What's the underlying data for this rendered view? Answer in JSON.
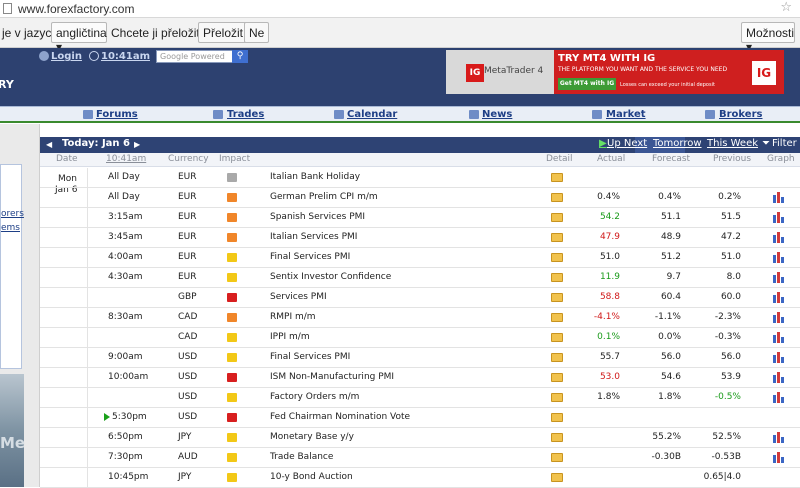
{
  "browser": {
    "url": "www.forexfactory.com"
  },
  "translate_bar": {
    "prefix": "je v jazyce",
    "language": "angličtina",
    "question": "Chcete ji přeložit?",
    "translate_btn": "Přeložit",
    "no_btn": "Ne",
    "options_btn": "Možnosti"
  },
  "header": {
    "logo_fragment": "RY",
    "login": "Login",
    "time": "10:41am",
    "search_placeholder": "Google Powered"
  },
  "ad": {
    "brand": "IG",
    "product": "MetaTrader 4",
    "headline": "TRY MT4 WITH IG",
    "subline": "THE PLATFORM YOU WANT AND THE SERVICE YOU NEED",
    "cta": "Get MT4 with IG",
    "disclaimer": "Losses can exceed your initial deposit"
  },
  "nav": {
    "forums": "Forums",
    "trades": "Trades",
    "calendar": "Calendar",
    "news": "News",
    "market": "Market",
    "brokers": "Brokers"
  },
  "left": {
    "link1": "orers",
    "link2": "ems",
    "img_text": "Me"
  },
  "calendar": {
    "today": "Today: Jan 6",
    "up_next": "Up Next",
    "tomorrow": "Tomorrow",
    "this_week": "This Week",
    "filter": "Filter",
    "columns": {
      "date": "Date",
      "time": "10:41am",
      "currency": "Currency",
      "impact": "Impact",
      "detail": "Detail",
      "actual": "Actual",
      "forecast": "Forecast",
      "previous": "Previous",
      "graph": "Graph"
    },
    "date_day": "Mon",
    "date_date": "Jan 6",
    "rows": [
      {
        "time": "All Day",
        "cur": "EUR",
        "impact": "gray",
        "event": "Italian Bank Holiday",
        "actual": "",
        "forecast": "",
        "previous": "",
        "actual_color": "",
        "graph": false
      },
      {
        "time": "All Day",
        "cur": "EUR",
        "impact": "orange",
        "event": "German Prelim CPI m/m",
        "actual": "0.4%",
        "forecast": "0.4%",
        "previous": "0.2%",
        "actual_color": "",
        "graph": true
      },
      {
        "time": "3:15am",
        "cur": "EUR",
        "impact": "orange",
        "event": "Spanish Services PMI",
        "actual": "54.2",
        "forecast": "51.1",
        "previous": "51.5",
        "actual_color": "green",
        "graph": true
      },
      {
        "time": "3:45am",
        "cur": "EUR",
        "impact": "orange",
        "event": "Italian Services PMI",
        "actual": "47.9",
        "forecast": "48.9",
        "previous": "47.2",
        "actual_color": "red",
        "graph": true
      },
      {
        "time": "4:00am",
        "cur": "EUR",
        "impact": "yellow",
        "event": "Final Services PMI",
        "actual": "51.0",
        "forecast": "51.2",
        "previous": "51.0",
        "actual_color": "",
        "graph": true
      },
      {
        "time": "4:30am",
        "cur": "EUR",
        "impact": "yellow",
        "event": "Sentix Investor Confidence",
        "actual": "11.9",
        "forecast": "9.7",
        "previous": "8.0",
        "actual_color": "green",
        "graph": true
      },
      {
        "time": "",
        "cur": "GBP",
        "impact": "red",
        "event": "Services PMI",
        "actual": "58.8",
        "forecast": "60.4",
        "previous": "60.0",
        "actual_color": "red",
        "graph": true
      },
      {
        "time": "8:30am",
        "cur": "CAD",
        "impact": "orange",
        "event": "RMPI m/m",
        "actual": "-4.1%",
        "forecast": "-1.1%",
        "previous": "-2.3%",
        "actual_color": "red",
        "graph": true
      },
      {
        "time": "",
        "cur": "CAD",
        "impact": "yellow",
        "event": "IPPI m/m",
        "actual": "0.1%",
        "forecast": "0.0%",
        "previous": "-0.3%",
        "actual_color": "green",
        "graph": true
      },
      {
        "time": "9:00am",
        "cur": "USD",
        "impact": "yellow",
        "event": "Final Services PMI",
        "actual": "55.7",
        "forecast": "56.0",
        "previous": "56.0",
        "actual_color": "",
        "graph": true
      },
      {
        "time": "10:00am",
        "cur": "USD",
        "impact": "red",
        "event": "ISM Non-Manufacturing PMI",
        "actual": "53.0",
        "forecast": "54.6",
        "previous": "53.9",
        "actual_color": "red",
        "graph": true
      },
      {
        "time": "",
        "cur": "USD",
        "impact": "yellow",
        "event": "Factory Orders m/m",
        "actual": "1.8%",
        "forecast": "1.8%",
        "previous": "-0.5%",
        "actual_color": "",
        "graph": true
      },
      {
        "time": "5:30pm",
        "cur": "USD",
        "impact": "red",
        "event": "Fed Chairman Nomination Vote",
        "actual": "",
        "forecast": "",
        "previous": "",
        "actual_color": "",
        "graph": false
      },
      {
        "time": "6:50pm",
        "cur": "JPY",
        "impact": "yellow",
        "event": "Monetary Base y/y",
        "actual": "",
        "forecast": "55.2%",
        "previous": "52.5%",
        "actual_color": "",
        "graph": true
      },
      {
        "time": "7:30pm",
        "cur": "AUD",
        "impact": "yellow",
        "event": "Trade Balance",
        "actual": "",
        "forecast": "-0.30B",
        "previous": "-0.53B",
        "actual_color": "",
        "graph": true
      },
      {
        "time": "10:45pm",
        "cur": "JPY",
        "impact": "yellow",
        "event": "10-y Bond Auction",
        "actual": "",
        "forecast": "",
        "previous": "0.65|4.0",
        "actual_color": "",
        "graph": false
      }
    ]
  },
  "colors": {
    "header": "#2d4170",
    "green": "#1a9a1a",
    "red": "#d01818"
  }
}
